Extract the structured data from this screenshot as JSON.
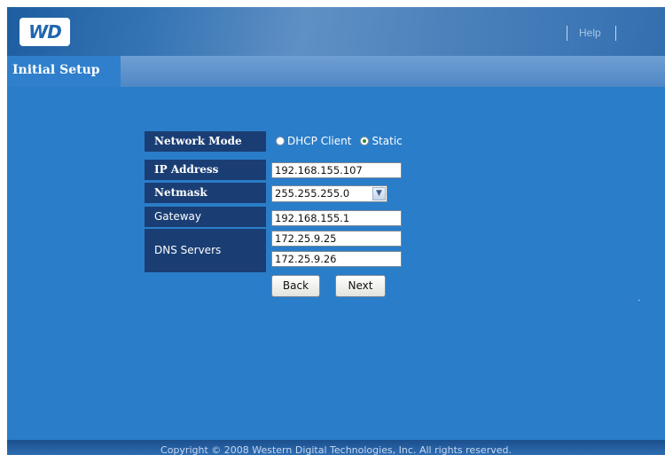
{
  "header": {
    "logo_text": "WD",
    "help_link": "Help"
  },
  "nav": {
    "active_tab": "Initial Setup"
  },
  "form": {
    "network_mode_label": "Network Mode",
    "dhcp_option": "DHCP Client",
    "static_option": "Static",
    "selected_mode": "Static",
    "ip_label": "IP Address",
    "ip_value": "192.168.155.107",
    "netmask_label": "Netmask",
    "netmask_value": "255.255.255.0",
    "gateway_label": "Gateway",
    "gateway_value": "192.168.155.1",
    "dns_label": "DNS Servers",
    "dns1_value": "172.25.9.25",
    "dns2_value": "172.25.9.26",
    "back_label": "Back",
    "next_label": "Next"
  },
  "footer": {
    "copyright": "Copyright © 2008 Western Digital Technologies, Inc. All rights reserved."
  },
  "colors": {
    "background": "#2a7dc9",
    "label_bg": "#1a3e74",
    "header_bg": "#3e78b6"
  }
}
